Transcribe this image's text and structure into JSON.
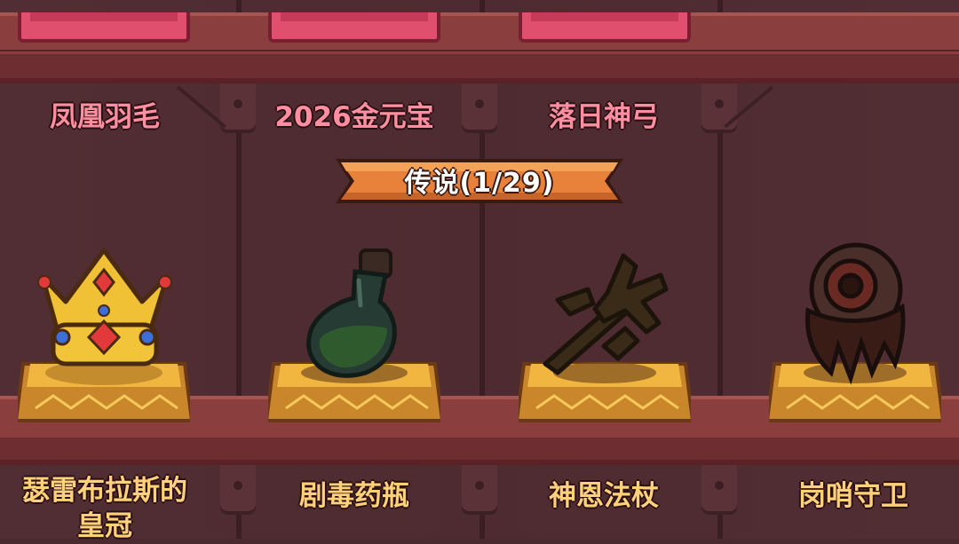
{
  "top_row": {
    "items": [
      {
        "name": "凤凰羽毛",
        "rarity": "epic"
      },
      {
        "name": "2026金元宝",
        "rarity": "epic"
      },
      {
        "name": "落日神弓",
        "rarity": "epic"
      }
    ]
  },
  "legend_section": {
    "header": "传说(1/29)",
    "items": [
      {
        "name_line1": "瑟雷布拉斯的",
        "name_line2": "皇冠",
        "icon": "crown-icon",
        "state": "collected"
      },
      {
        "name_line1": "剧毒药瓶",
        "icon": "poison-bottle-icon",
        "state": "locked"
      },
      {
        "name_line1": "神恩法杖",
        "icon": "staff-icon",
        "state": "locked"
      },
      {
        "name_line1": "岗哨守卫",
        "icon": "eyeball-icon",
        "state": "locked"
      }
    ]
  },
  "colors": {
    "epic_name": "#ff8fa0",
    "legend_name": "#ffd27a",
    "banner": "#e8823a",
    "pedestal_gold": "#f0b640"
  }
}
